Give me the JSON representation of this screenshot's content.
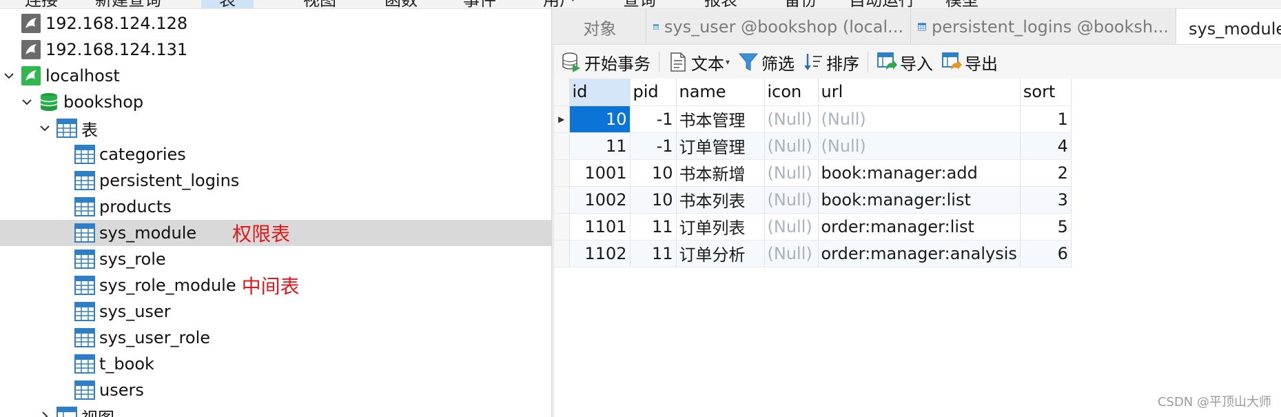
{
  "menu": [
    "连接",
    "新建查询",
    "表",
    "视图",
    "函数",
    "事件",
    "用户",
    "查询",
    "报表",
    "备份",
    "自动运行",
    "模型"
  ],
  "tree": {
    "connections": [
      "192.168.124.128",
      "192.168.124.131",
      "localhost"
    ],
    "database": "bookshop",
    "tables_group": "表",
    "tables": [
      "categories",
      "persistent_logins",
      "products",
      "sys_module",
      "sys_role",
      "sys_role_module",
      "sys_user",
      "sys_user_role",
      "t_book",
      "users"
    ],
    "views_group": "视图",
    "selected_table": "sys_module",
    "annotations": {
      "sys_module": "权限表",
      "sys_role_module": "中间表"
    }
  },
  "tabs": [
    {
      "label": "对象"
    },
    {
      "label": "sys_user @bookshop (local..."
    },
    {
      "label": "persistent_logins @booksh..."
    },
    {
      "label": "sys_module @bookshop (localhost) - 表"
    }
  ],
  "toolbar": {
    "begin_tx": "开始事务",
    "text": "文本",
    "filter": "筛选",
    "sort": "排序",
    "import": "导入",
    "export": "导出"
  },
  "grid": {
    "columns": [
      "id",
      "pid",
      "name",
      "icon",
      "url",
      "sort"
    ],
    "rows": [
      [
        "10",
        "-1",
        "书本管理",
        "(Null)",
        "(Null)",
        "1"
      ],
      [
        "11",
        "-1",
        "订单管理",
        "(Null)",
        "(Null)",
        "4"
      ],
      [
        "1001",
        "10",
        "书本新增",
        "(Null)",
        "book:manager:add",
        "2"
      ],
      [
        "1002",
        "10",
        "书本列表",
        "(Null)",
        "book:manager:list",
        "3"
      ],
      [
        "1101",
        "11",
        "订单列表",
        "(Null)",
        "order:manager:list",
        "5"
      ],
      [
        "1102",
        "11",
        "订单分析",
        "(Null)",
        "order:manager:analysis",
        "6"
      ]
    ]
  },
  "watermark": "CSDN @平顶山大师",
  "colors": {
    "selection": "#0b74d6",
    "annotation": "#e0181b",
    "null_text": "#a9b1c4",
    "tree_selected": "#d9d9d9"
  }
}
